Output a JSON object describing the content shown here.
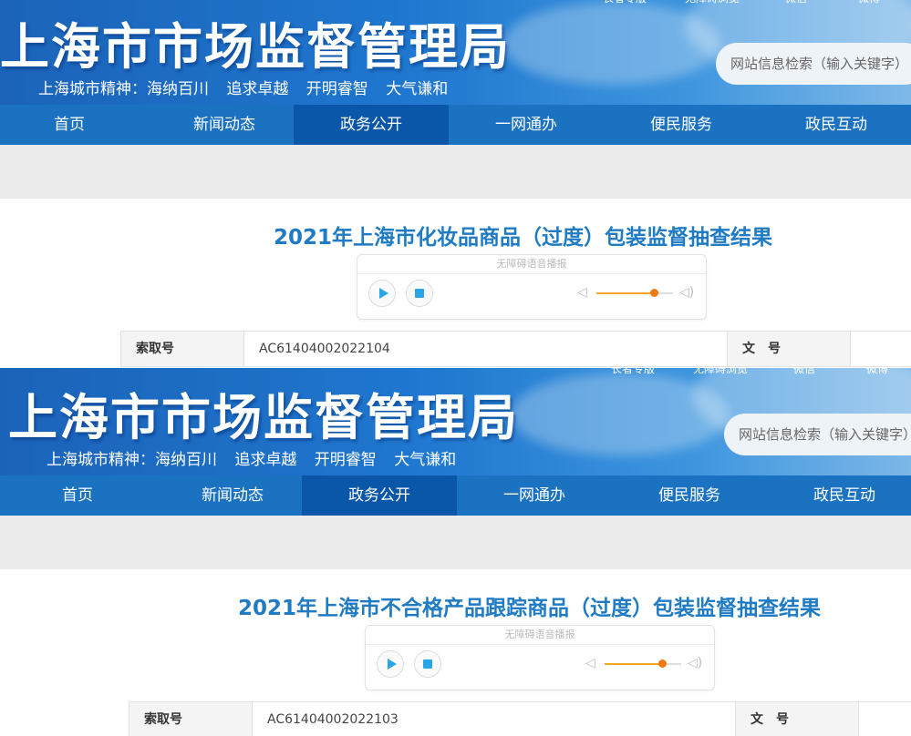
{
  "site": {
    "title": "上海市市场监督管理局",
    "slogan": "上海城市精神：海纳百川   追求卓越   开明睿智   大气谦和",
    "top_links": [
      "长者专版",
      "无障碍浏览",
      "微信",
      "微博"
    ],
    "search_placeholder": "网站信息检索（输入关键字）"
  },
  "nav": {
    "items": [
      "首页",
      "新闻动态",
      "政务公开",
      "一网通办",
      "便民服务",
      "政民互动"
    ],
    "active": "政务公开"
  },
  "player": {
    "title": "无障碍语音播报",
    "volume_level": 0.75
  },
  "meta_labels": {
    "index_label": "索取号",
    "doc_label": "文　号"
  },
  "articles": [
    {
      "title": "2021年上海市化妆品商品（过度）包装监督抽查结果",
      "index_no": "AC61404002022104"
    },
    {
      "title": "2021年上海市不合格产品跟踪商品（过度）包装监督抽查结果",
      "index_no": "AC61404002022103"
    }
  ],
  "colors": {
    "nav": "#1b72c1",
    "nav_active": "#0a56a8",
    "title": "#1f7bc4",
    "accent_orange": "#f07a12"
  }
}
